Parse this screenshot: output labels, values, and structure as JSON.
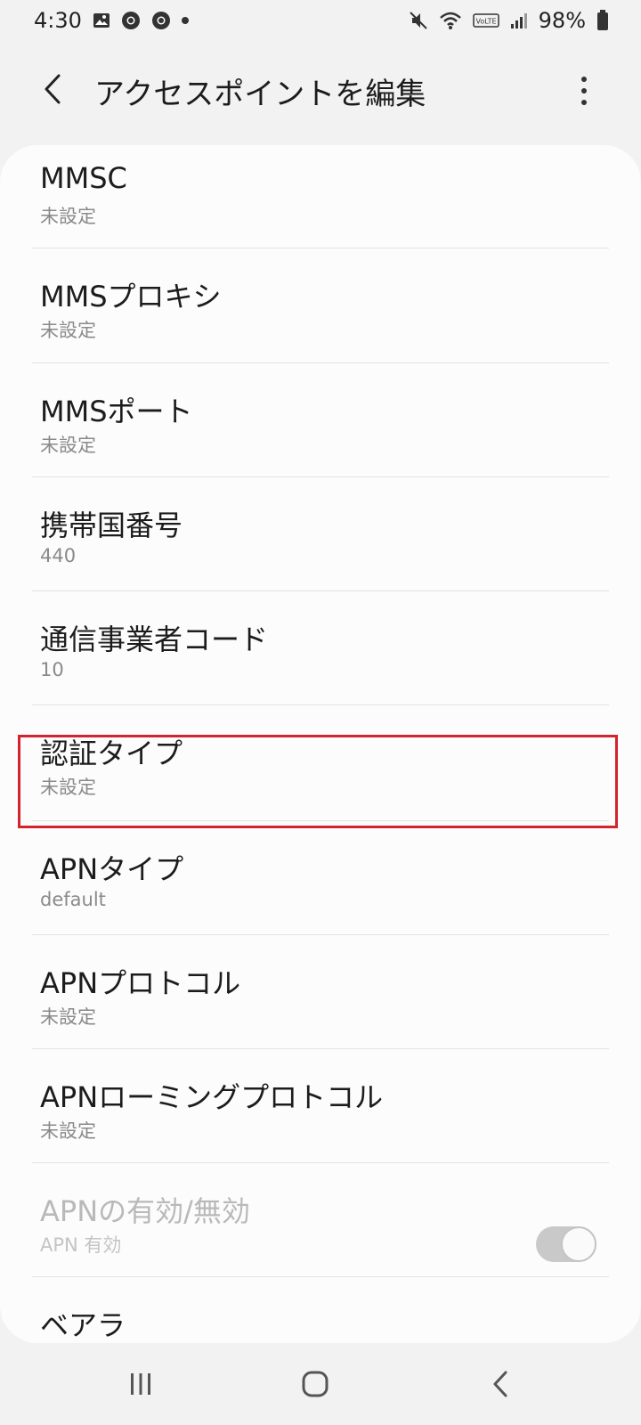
{
  "status_bar": {
    "time": "4:30",
    "battery": "98%",
    "icons": [
      "gallery-icon",
      "chrome-icon",
      "chrome-icon",
      "dot-icon",
      "mute-icon",
      "wifi-icon",
      "volte-icon",
      "signal-icon",
      "battery-icon"
    ]
  },
  "header": {
    "title": "アクセスポイントを編集"
  },
  "items": [
    {
      "title": "MMSC",
      "subtitle": "未設定"
    },
    {
      "title": "MMSプロキシ",
      "subtitle": "未設定"
    },
    {
      "title": "MMSポート",
      "subtitle": "未設定"
    },
    {
      "title": "携帯国番号",
      "subtitle": "440"
    },
    {
      "title": "通信事業者コード",
      "subtitle": "10"
    },
    {
      "title": "認証タイプ",
      "subtitle": "未設定"
    },
    {
      "title": "APNタイプ",
      "subtitle": "default"
    },
    {
      "title": "APNプロトコル",
      "subtitle": "未設定"
    },
    {
      "title": "APNローミングプロトコル",
      "subtitle": "未設定"
    },
    {
      "title": "APNの有効/無効",
      "subtitle": "APN 有効",
      "toggle": true,
      "disabled": true
    },
    {
      "title": "ベアラ",
      "subtitle": ""
    }
  ],
  "colors": {
    "highlight": "#d3232f",
    "background": "#f2f2f2",
    "card": "#fcfcfc"
  }
}
